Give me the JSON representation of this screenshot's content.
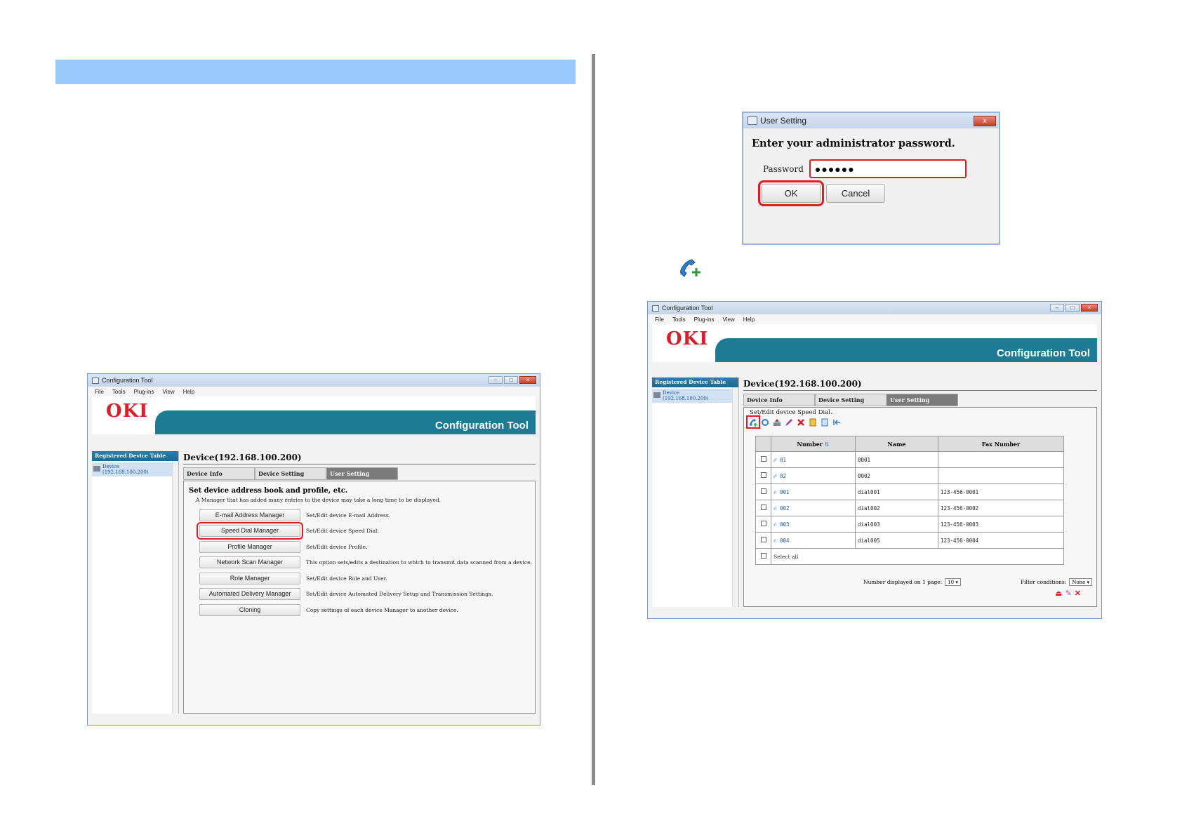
{
  "config_window": {
    "title": "Configuration Tool",
    "menu": [
      "File",
      "Tools",
      "Plug-ins",
      "View",
      "Help"
    ],
    "logo": "OKI",
    "banner_title": "Configuration Tool",
    "sidebar_header": "Registered Device Table",
    "device_label": "Device",
    "device_ip": "(192.168.100.200)",
    "device_title": "Device(192.168.100.200)",
    "tabs": [
      "Device Info",
      "Device Setting",
      "User Setting"
    ]
  },
  "manager_panel": {
    "heading": "Set device address book and profile, etc.",
    "note": "A Manager that has added many entries to the device may take a long time to be displayed.",
    "rows": [
      {
        "button": "E-mail Address Manager",
        "desc": "Set/Edit device E-mail Address."
      },
      {
        "button": "Speed Dial Manager",
        "desc": "Set/Edit device Speed Dial."
      },
      {
        "button": "Profile Manager",
        "desc": "Set/Edit device Profile."
      },
      {
        "button": "Network Scan Manager",
        "desc": "This option sets/edits a destination to which to transmit data scanned from a device."
      },
      {
        "button": "Role Manager",
        "desc": "Set/Edit device Role and User."
      },
      {
        "button": "Automated Delivery Manager",
        "desc": "Set/Edit device Automated Delivery Setup and Transmission Settings."
      },
      {
        "button": "Cloning",
        "desc": "Copy settings of each device Manager to another device."
      }
    ]
  },
  "dialog": {
    "title": "User Setting",
    "close": "x",
    "message": "Enter your administrator password.",
    "password_label": "Password",
    "password_value": "●●●●●●",
    "ok": "OK",
    "cancel": "Cancel"
  },
  "speed_dial_panel": {
    "label": "Set/Edit device Speed Dial.",
    "columns": [
      "Number",
      "Name",
      "Fax Number"
    ],
    "rows": [
      {
        "number": "01",
        "name": "0001",
        "fax": ""
      },
      {
        "number": "02",
        "name": "0002",
        "fax": ""
      },
      {
        "number": "001",
        "name": "dial001",
        "fax": "123-456-0001"
      },
      {
        "number": "002",
        "name": "dial002",
        "fax": "123-456-0002"
      },
      {
        "number": "003",
        "name": "dial003",
        "fax": "123-456-0003"
      },
      {
        "number": "004",
        "name": "dial005",
        "fax": "123-456-0004"
      }
    ],
    "select_all": "Select all",
    "per_page_label": "Number displayed on 1 page:",
    "per_page_value": "10",
    "filter_label": "Filter conditions:",
    "filter_value": "None"
  },
  "colors": {
    "heading_bar": "#99c9fb",
    "highlight": "#e01b24",
    "oki_red": "#d8202b",
    "banner_teal": "#1d7b95"
  }
}
